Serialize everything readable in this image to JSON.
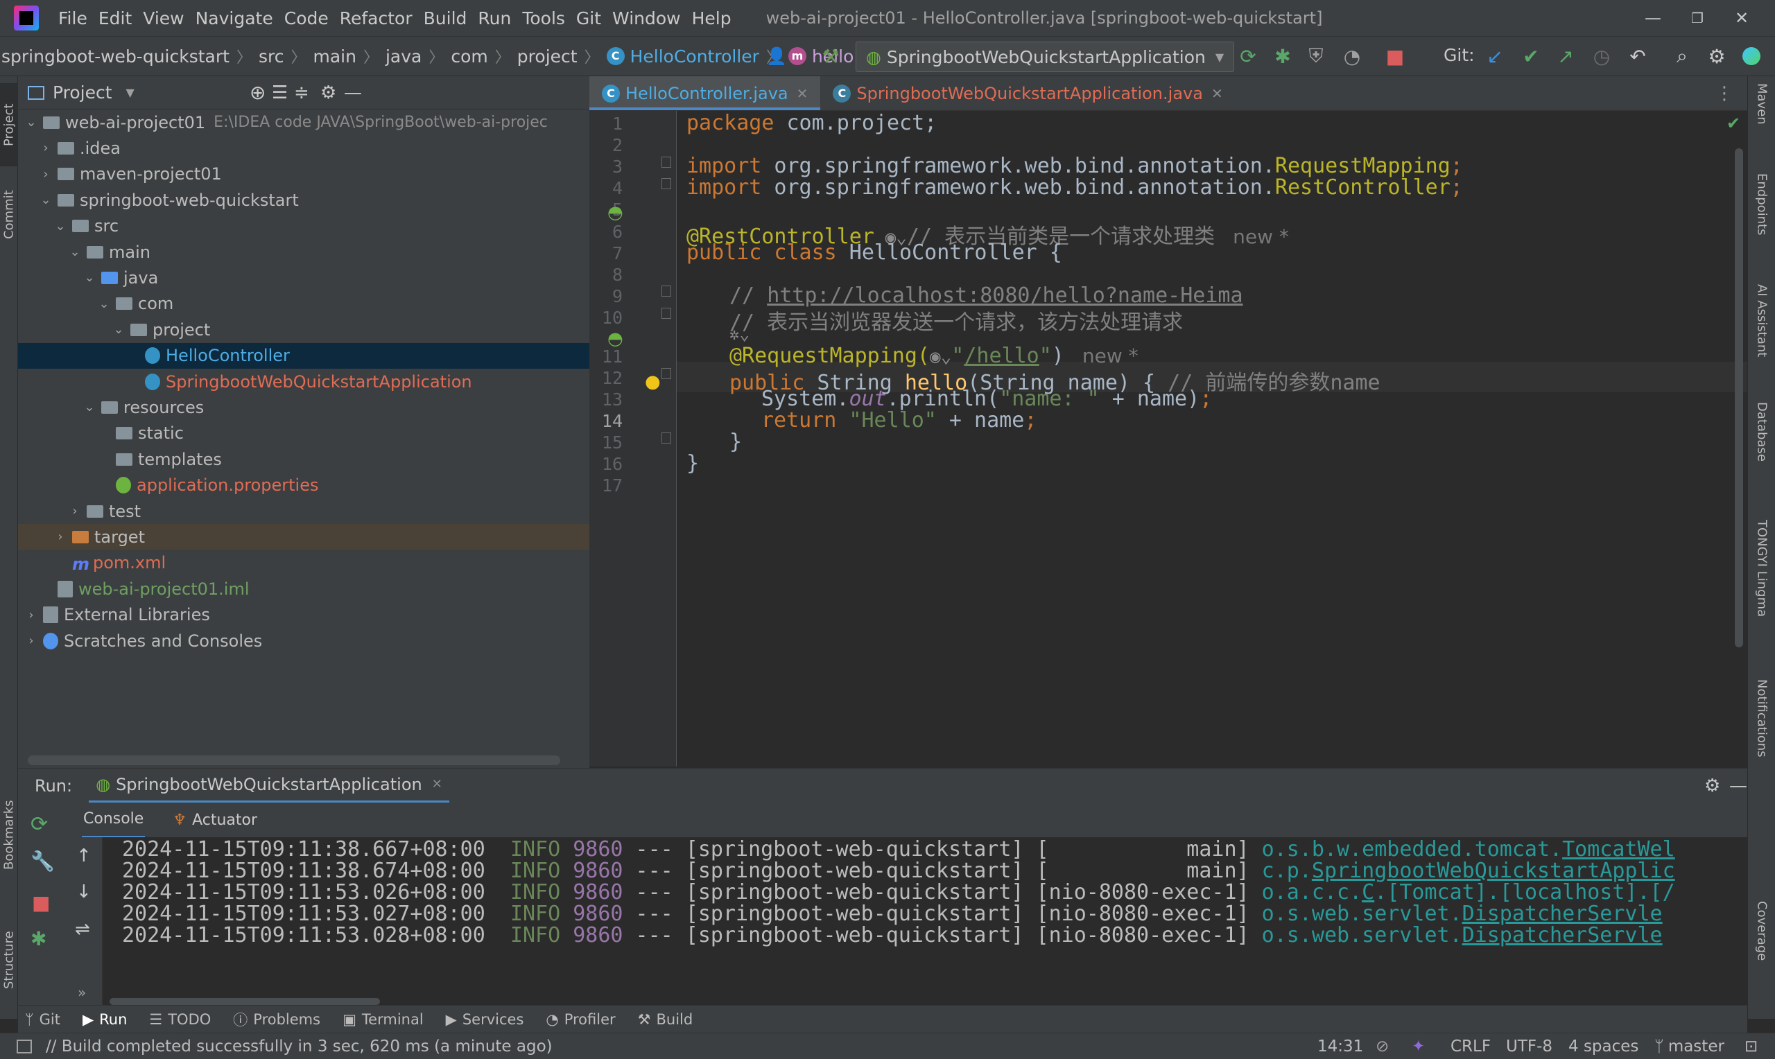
{
  "app": {
    "window_title": "web-ai-project01 - HelloController.java [springboot-web-quickstart]",
    "menu": [
      "File",
      "Edit",
      "View",
      "Navigate",
      "Code",
      "Refactor",
      "Build",
      "Run",
      "Tools",
      "Git",
      "Window",
      "Help"
    ]
  },
  "breadcrumb": [
    "springboot-web-quickstart",
    "src",
    "main",
    "java",
    "com",
    "project",
    "HelloController",
    "hello"
  ],
  "toolbar": {
    "run_config": "SpringbootWebQuickstartApplication",
    "git_label": "Git:"
  },
  "project_panel": {
    "title": "Project",
    "tree": [
      {
        "label": "web-ai-project01",
        "extra": "E:\\IDEA code JAVA\\SpringBoot\\web-ai-projec",
        "indent": 0,
        "icon": "module-folder-icon",
        "expanded": true,
        "color": "#bbbbbb"
      },
      {
        "label": ".idea",
        "indent": 1,
        "icon": "folder-icon",
        "expanded": false,
        "color": "#bbbbbb"
      },
      {
        "label": "maven-project01",
        "indent": 1,
        "icon": "module-folder-icon",
        "expanded": false,
        "color": "#bbbbbb"
      },
      {
        "label": "springboot-web-quickstart",
        "indent": 1,
        "icon": "module-folder-icon",
        "expanded": true,
        "color": "#bbbbbb"
      },
      {
        "label": "src",
        "indent": 2,
        "icon": "folder-icon",
        "expanded": true,
        "color": "#bbbbbb"
      },
      {
        "label": "main",
        "indent": 3,
        "icon": "folder-icon",
        "expanded": true,
        "color": "#bbbbbb"
      },
      {
        "label": "java",
        "indent": 4,
        "icon": "source-folder-icon",
        "expanded": true,
        "color": "#bbbbbb"
      },
      {
        "label": "com",
        "indent": 5,
        "icon": "package-icon",
        "expanded": true,
        "color": "#bbbbbb"
      },
      {
        "label": "project",
        "indent": 6,
        "icon": "package-icon",
        "expanded": true,
        "color": "#bbbbbb"
      },
      {
        "label": "HelloController",
        "indent": 7,
        "icon": "class-icon",
        "leaf": true,
        "color": "#4eade5",
        "selected": true
      },
      {
        "label": "SpringbootWebQuickstartApplication",
        "indent": 7,
        "icon": "spring-class-icon",
        "leaf": true,
        "color": "#e06c54"
      },
      {
        "label": "resources",
        "indent": 4,
        "icon": "resources-folder-icon",
        "expanded": true,
        "color": "#bbbbbb"
      },
      {
        "label": "static",
        "indent": 5,
        "icon": "folder-icon",
        "leaf": true,
        "color": "#bbbbbb"
      },
      {
        "label": "templates",
        "indent": 5,
        "icon": "folder-icon",
        "leaf": true,
        "color": "#bbbbbb"
      },
      {
        "label": "application.properties",
        "indent": 5,
        "icon": "spring-properties-icon",
        "leaf": true,
        "color": "#e06c54"
      },
      {
        "label": "test",
        "indent": 3,
        "icon": "folder-icon",
        "expanded": false,
        "color": "#bbbbbb"
      },
      {
        "label": "target",
        "indent": 2,
        "icon": "excluded-folder-icon",
        "expanded": false,
        "color": "#bbbbbb",
        "target": true
      },
      {
        "label": "pom.xml",
        "indent": 2,
        "icon": "maven-icon",
        "leaf": true,
        "color": "#e06c54"
      },
      {
        "label": "web-ai-project01.iml",
        "indent": 1,
        "icon": "iml-file-icon",
        "leaf": true,
        "color": "#6f9f62"
      },
      {
        "label": "External Libraries",
        "indent": 0,
        "icon": "libraries-icon",
        "expanded": false,
        "color": "#bbbbbb"
      },
      {
        "label": "Scratches and Consoles",
        "indent": 0,
        "icon": "scratches-icon",
        "expanded": false,
        "color": "#bbbbbb"
      }
    ]
  },
  "editor": {
    "tabs": [
      {
        "label": "HelloController.java",
        "active": true,
        "color": "#4eade5"
      },
      {
        "label": "SpringbootWebQuickstartApplication.java",
        "active": false,
        "color": "#e06c54"
      }
    ],
    "line_numbers": [
      "1",
      "2",
      "3",
      "4",
      "5",
      "6",
      "7",
      "8",
      "9",
      "10",
      "",
      "11",
      "12",
      "13",
      "14",
      "15",
      "16",
      "17"
    ],
    "current_line": "14",
    "code": {
      "l1_kw": "package",
      "l1_rest": " com.project;",
      "l3_kw": "import",
      "l3_pkg": " org.springframework.web.bind.annotation.",
      "l3_cls": "RequestMapping",
      "l3_semi": ";",
      "l4_kw": "import",
      "l4_pkg": " org.springframework.web.bind.annotation.",
      "l4_cls": "RestController",
      "l4_semi": ";",
      "l6_ann": "@RestController",
      "l6_cmt": "// 表示当前类是一个请求处理类",
      "l6_hint": "new *",
      "l7_kw": "public class",
      "l7_rest": " HelloController {",
      "l9_cmt": "// ",
      "l9_link": "http://localhost:8080/hello?name-Heima",
      "l10_cmt": "// 表示当浏览器发送一个请求，该方法处理请求",
      "l11_ann": "@RequestMapping(",
      "l11_q1": "\"",
      "l11_str": "/hello",
      "l11_q2": "\"",
      "l11_close": ")",
      "l11_hint": "new *",
      "l12_kw": "public",
      "l12_type": " String ",
      "l12_fn": "hello",
      "l12_args": "(String name) { ",
      "l12_cmt": "// 前端传的参数name",
      "l13_a": "System.",
      "l13_out": "out",
      "l13_b": ".println(",
      "l13_str": "\"name: \"",
      "l13_c": " + name)",
      "l13_semi": ";",
      "l14_kw": "return",
      "l14_str": " \"Hello\"",
      "l14_rest": " + name",
      "l14_semi": ";",
      "l15": "}",
      "l16": "}"
    }
  },
  "run_panel": {
    "label": "Run:",
    "config_tab": "SpringbootWebQuickstartApplication",
    "subtabs": [
      "Console",
      "Actuator"
    ],
    "logs": [
      {
        "ts": "2024-11-15T09:11:38.667+08:00",
        "level": "INFO",
        "pid": "9860",
        "sep": "---",
        "app": "[springboot-web-quickstart]",
        "thread": "[           main]",
        "logger_pre": "o.s.b.w.embedded.tomcat.",
        "logger_link": "TomcatWel"
      },
      {
        "ts": "2024-11-15T09:11:38.674+08:00",
        "level": "INFO",
        "pid": "9860",
        "sep": "---",
        "app": "[springboot-web-quickstart]",
        "thread": "[           main]",
        "logger_pre": "c.p.",
        "logger_link": "SpringbootWebQuickstartApplic"
      },
      {
        "ts": "2024-11-15T09:11:53.026+08:00",
        "level": "INFO",
        "pid": "9860",
        "sep": "---",
        "app": "[springboot-web-quickstart]",
        "thread": "[nio-8080-exec-1]",
        "logger_pre": "o.a.c.c.",
        "logger_link": "C",
        "logger_post": ".[Tomcat].[localhost].[/"
      },
      {
        "ts": "2024-11-15T09:11:53.027+08:00",
        "level": "INFO",
        "pid": "9860",
        "sep": "---",
        "app": "[springboot-web-quickstart]",
        "thread": "[nio-8080-exec-1]",
        "logger_pre": "o.s.web.servlet.",
        "logger_link": "DispatcherServle"
      },
      {
        "ts": "2024-11-15T09:11:53.028+08:00",
        "level": "INFO",
        "pid": "9860",
        "sep": "---",
        "app": "[springboot-web-quickstart]",
        "thread": "[nio-8080-exec-1]",
        "logger_pre": "o.s.web.servlet.",
        "logger_link": "DispatcherServle"
      }
    ]
  },
  "left_strip": {
    "project": "Project",
    "commit": "Commit",
    "bookmarks": "Bookmarks",
    "structure": "Structure"
  },
  "right_strip": {
    "maven": "Maven",
    "endpoints": "Endpoints",
    "ai_assistant": "AI Assistant",
    "database": "Database",
    "tongyi": "TONGYI Lingma",
    "notifications": "Notifications",
    "coverage": "Coverage"
  },
  "bottom_tabs": [
    "Git",
    "Run",
    "TODO",
    "Problems",
    "Terminal",
    "Services",
    "Profiler",
    "Build"
  ],
  "status": {
    "message": "// Build completed successfully in 3 sec, 620 ms (a minute ago)",
    "position": "14:31",
    "line_sep": "CRLF",
    "encoding": "UTF-8",
    "indent": "4 spaces",
    "branch": "master"
  }
}
